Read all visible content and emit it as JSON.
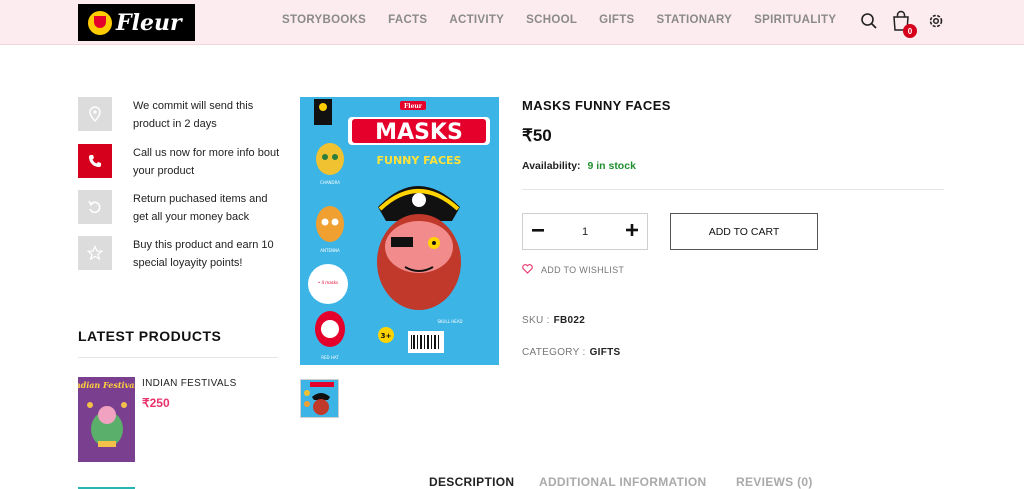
{
  "brand": {
    "logo_text": "Fleur"
  },
  "nav": {
    "items": [
      {
        "label": "STORYBOOKS"
      },
      {
        "label": "FACTS"
      },
      {
        "label": "ACTIVITY"
      },
      {
        "label": "SCHOOL"
      },
      {
        "label": "GIFTS"
      },
      {
        "label": "STATIONARY"
      },
      {
        "label": "SPIRITUALITY"
      }
    ],
    "cart_count": "0",
    "icons": [
      "search-icon",
      "cart-icon",
      "settings-icon"
    ]
  },
  "info": [
    {
      "icon": "location-pin-icon",
      "text": "We commit will send this product in 2 days"
    },
    {
      "icon": "phone-icon",
      "text": "Call us now for more info bout your product"
    },
    {
      "icon": "return-icon",
      "text": "Return puchased items and get all your money back"
    },
    {
      "icon": "star-icon",
      "text": "Buy this product and earn 10 special loyayity points!"
    }
  ],
  "latest": {
    "title": "LATEST PRODUCTS",
    "items": [
      {
        "name": "INDIAN FESTIVALS",
        "price": "₹250",
        "cover_title": "Indian Festivals"
      }
    ]
  },
  "product": {
    "title": "MASKS FUNNY FACES",
    "price": "₹50",
    "availability_label": "Availability:",
    "availability_value": "9 in stock",
    "quantity": "1",
    "add_to_cart": "ADD TO CART",
    "wishlist": "ADD TO WISHLIST",
    "sku_label": "SKU :",
    "sku_value": "FB022",
    "category_label": "CATEGORY :",
    "category_value": "GIFTS",
    "cover": {
      "headline": "MASKS",
      "sub": "FUNNY FACES",
      "logo": "Fleur",
      "age_badge": "3+",
      "mask_labels": [
        "CHANDRA",
        "ANTENNA",
        "RED HAT",
        "SKULL HEAD"
      ]
    }
  },
  "tabs": [
    {
      "label": "DESCRIPTION",
      "active": true
    },
    {
      "label": "ADDITIONAL INFORMATION",
      "active": false
    },
    {
      "label": "REVIEWS (0)",
      "active": false
    }
  ],
  "colors": {
    "accent_red": "#d4001c",
    "price_pink": "#e8336b",
    "stock_green": "#1f8f2f",
    "header_bg": "#fcebef",
    "cover_blue": "#3cb4e6"
  }
}
